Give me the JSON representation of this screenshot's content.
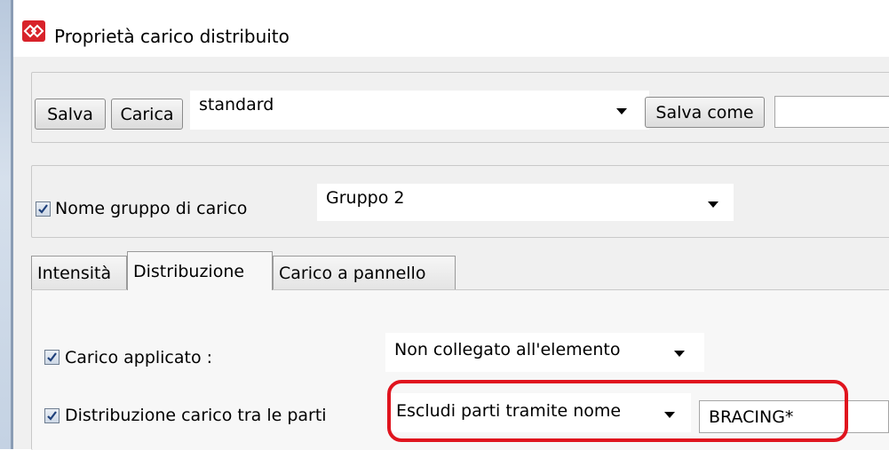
{
  "window": {
    "title": "Proprietà carico distribuito"
  },
  "toolbar": {
    "save_label": "Salva",
    "load_label": "Carica",
    "preset_value": "standard",
    "save_as_label": "Salva come",
    "save_as_value": ""
  },
  "load_group": {
    "label": "Nome gruppo di carico",
    "checked": true,
    "value": "Gruppo 2"
  },
  "tabs": [
    {
      "label": "Intensità",
      "active": false
    },
    {
      "label": "Distribuzione",
      "active": true
    },
    {
      "label": "Carico a pannello",
      "active": false
    }
  ],
  "distribution": {
    "applied_label": "Carico applicato :",
    "applied_value": "Non collegato all'elemento",
    "parts_label": "Distribuzione carico tra le parti",
    "parts_value": "Escludi parti tramite nome",
    "parts_filter": "BRACING*"
  },
  "colors": {
    "highlight": "#e0141e",
    "app_icon": "#d8222a"
  }
}
